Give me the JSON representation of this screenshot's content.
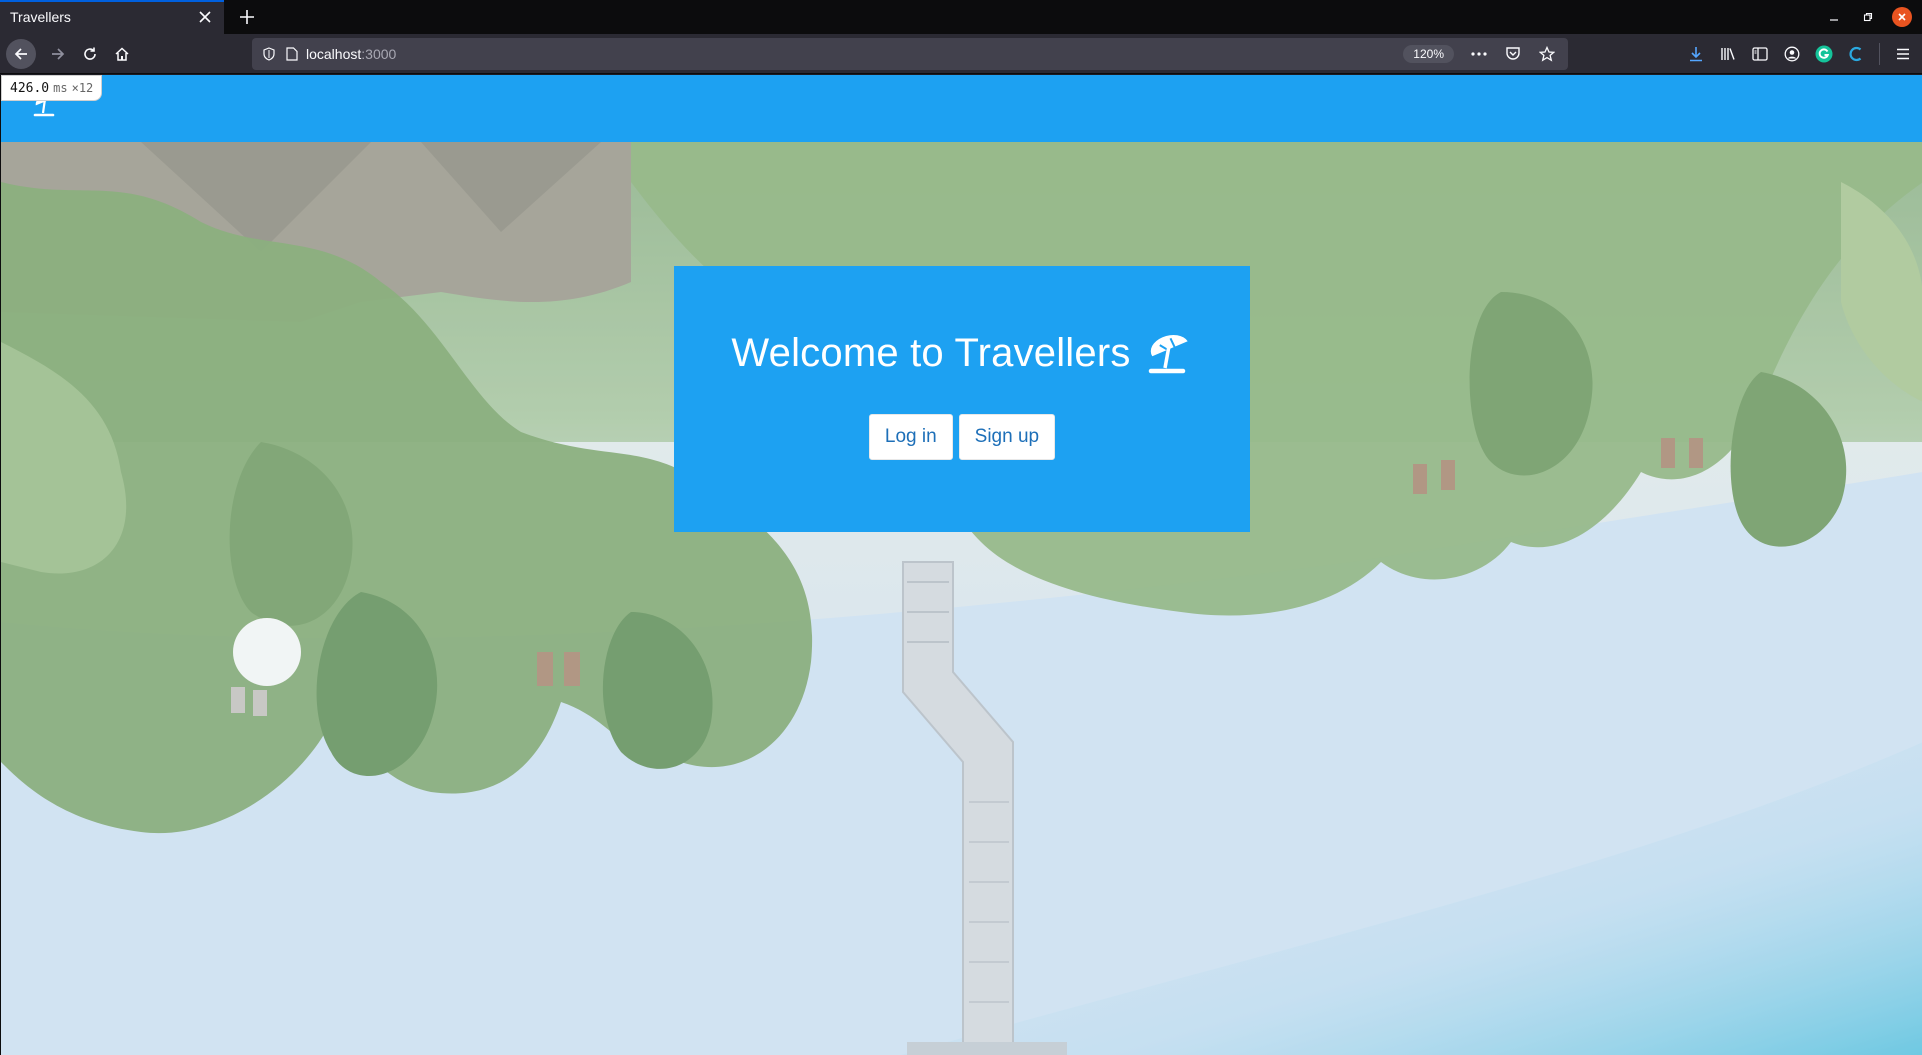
{
  "browser": {
    "tab_title": "Travellers",
    "url_host": "localhost",
    "url_port": ":3000",
    "zoom": "120%"
  },
  "perf_overlay": {
    "value": "426.0",
    "unit": "ms",
    "count": "×12"
  },
  "site": {
    "welcome_text": "Welcome to Travellers",
    "logo_icon": "beach-umbrella-icon",
    "login_label": "Log in",
    "signup_label": "Sign up"
  },
  "colors": {
    "brand_blue": "#1da1f2",
    "button_text": "#1d6fb8"
  }
}
